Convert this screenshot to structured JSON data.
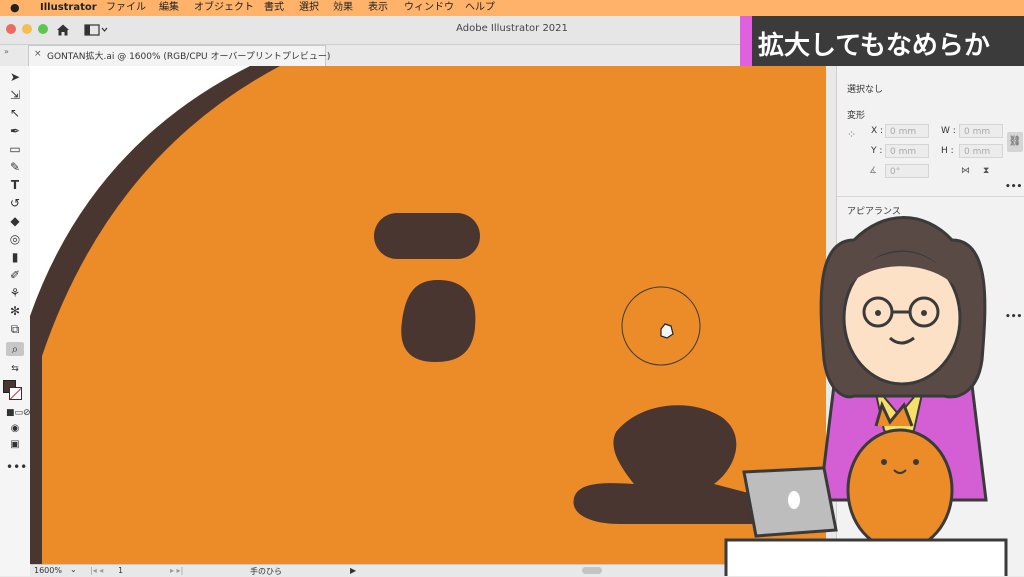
{
  "menubar": {
    "app_name": "Illustrator",
    "items": [
      "ファイル",
      "編集",
      "オブジェクト",
      "書式",
      "選択",
      "効果",
      "表示",
      "ウィンドウ",
      "ヘルプ"
    ]
  },
  "window": {
    "title": "Adobe Illustrator 2021"
  },
  "document_tab": {
    "label": "GONTAN拡大.ai @ 1600% (RGB/CPU オーバープリントプレビュー)"
  },
  "status_bar": {
    "zoom": "1600%",
    "artboard": "1",
    "tool": "手のひら"
  },
  "properties_panel": {
    "selection": "選択なし",
    "transform_heading": "変形",
    "x_label": "X :",
    "y_label": "Y :",
    "w_label": "W :",
    "h_label": "H :",
    "x_value": "0 mm",
    "y_value": "0 mm",
    "w_value": "0 mm",
    "h_value": "0 mm",
    "angle_value": "0°",
    "appearance_heading": "アピアランス"
  },
  "caption": {
    "text": "拡大してもなめらか"
  },
  "colors": {
    "menubar": "#ffb36a",
    "artwork_orange": "#ec8c28",
    "artwork_brown": "#4a3631",
    "caption_bg": "#3b3b3b",
    "caption_accent": "#e061e0"
  }
}
